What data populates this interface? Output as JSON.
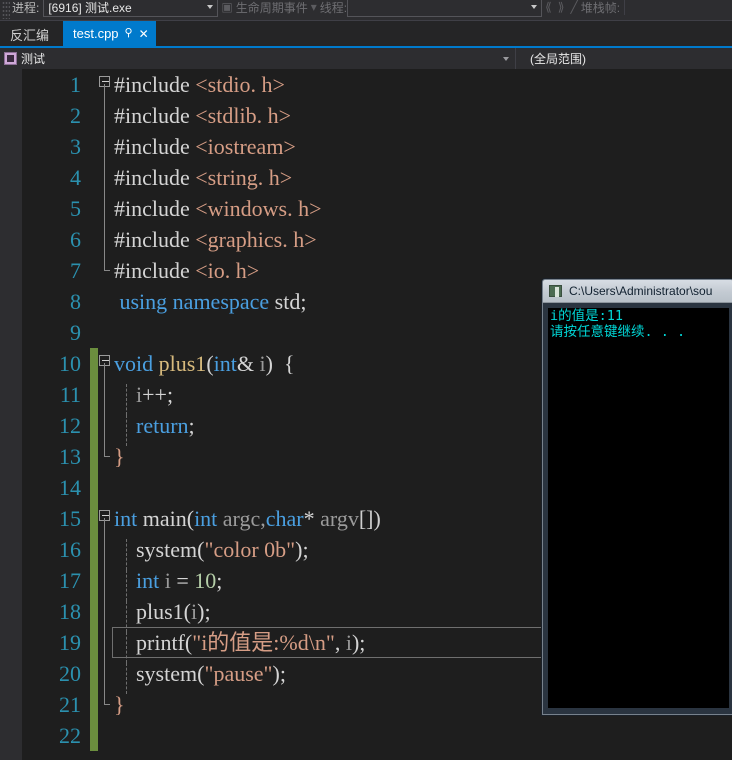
{
  "toolbar": {
    "process_label": "进程:",
    "process_value": "[6916] 测试.exe",
    "lifecycle_label": "生命周期事件",
    "thread_label": "线程:",
    "thread_value": "",
    "stack_label": "堆栈帧:",
    "icons": [
      "lifecycle-icon",
      "step-back-icon",
      "step-forward-icon",
      "no-symbol-icon"
    ]
  },
  "tabs": {
    "inactive_label": "反汇编",
    "active": {
      "name": "test.cpp",
      "pin_icon": "⚲",
      "close_icon": "✕"
    }
  },
  "navbar": {
    "project_icon": "project-icon",
    "project": "测试",
    "scope": "(全局范围)"
  },
  "editor": {
    "accent_color": "#007acc",
    "changebar_color": "#6b8e3e",
    "lineno_color": "#2b91af",
    "current_line": 19,
    "lines": [
      {
        "n": 1,
        "changed": false,
        "fold": "box",
        "indent": false,
        "html": "<span class=\"pl\">#include </span><span class=\"inc\">&lt;stdio. h&gt;</span>"
      },
      {
        "n": 2,
        "changed": false,
        "fold": "pipe",
        "indent": false,
        "html": "<span class=\"pl\">#include </span><span class=\"inc\">&lt;stdlib. h&gt;</span>"
      },
      {
        "n": 3,
        "changed": false,
        "fold": "pipe",
        "indent": false,
        "html": "<span class=\"pl\">#include </span><span class=\"inc\">&lt;iostream&gt;</span>"
      },
      {
        "n": 4,
        "changed": false,
        "fold": "pipe",
        "indent": false,
        "html": "<span class=\"pl\">#include </span><span class=\"inc\">&lt;string. h&gt;</span>"
      },
      {
        "n": 5,
        "changed": false,
        "fold": "pipe",
        "indent": false,
        "html": "<span class=\"pl\">#include </span><span class=\"inc\">&lt;windows. h&gt;</span>"
      },
      {
        "n": 6,
        "changed": false,
        "fold": "pipe",
        "indent": false,
        "html": "<span class=\"pl\">#include </span><span class=\"inc\">&lt;graphics. h&gt;</span>"
      },
      {
        "n": 7,
        "changed": false,
        "fold": "elbow",
        "indent": false,
        "html": "<span class=\"pl\">#include </span><span class=\"inc\">&lt;io. h&gt;</span>"
      },
      {
        "n": 8,
        "changed": false,
        "fold": "none",
        "indent": false,
        "html": " <span class=\"kw\">using namespace</span> <span class=\"pl\">std;</span>"
      },
      {
        "n": 9,
        "changed": false,
        "fold": "none",
        "indent": false,
        "html": ""
      },
      {
        "n": 10,
        "changed": true,
        "fold": "box",
        "indent": false,
        "html": "<span class=\"kw\">void</span> <span class=\"fn\">plus1</span><span class=\"pl\">(</span><span class=\"kw\">int</span><span class=\"pl\">&amp; </span><span class=\"id\">i</span><span class=\"pl\">)  {</span>"
      },
      {
        "n": 11,
        "changed": true,
        "fold": "pipe",
        "indent": true,
        "html": "    <span class=\"id\">i</span><span class=\"pl\">++;</span>"
      },
      {
        "n": 12,
        "changed": true,
        "fold": "pipe",
        "indent": true,
        "html": "    <span class=\"kw\">return</span><span class=\"pl\">;</span>"
      },
      {
        "n": 13,
        "changed": true,
        "fold": "elbow",
        "indent": false,
        "html": "<span class=\"str\">}</span>"
      },
      {
        "n": 14,
        "changed": true,
        "fold": "none",
        "indent": false,
        "html": ""
      },
      {
        "n": 15,
        "changed": true,
        "fold": "box",
        "indent": false,
        "html": "<span class=\"kw\">int</span> <span class=\"pl\">main(</span><span class=\"kw\">int</span> <span class=\"id\">argc,</span><span class=\"kw\">char</span><span class=\"pl\">* </span><span class=\"id\">argv</span><span class=\"brk\">[])</span>"
      },
      {
        "n": 16,
        "changed": true,
        "fold": "pipe",
        "indent": true,
        "html": "    <span class=\"pl\">system(</span><span class=\"dq\">&quot;</span><span class=\"str\">color 0b</span><span class=\"dq\">&quot;</span><span class=\"pl\">);</span>"
      },
      {
        "n": 17,
        "changed": true,
        "fold": "pipe",
        "indent": true,
        "html": "    <span class=\"kw\">int</span> <span class=\"id\">i</span> <span class=\"pl\">= </span><span class=\"num\">10</span><span class=\"pl\">;</span>"
      },
      {
        "n": 18,
        "changed": true,
        "fold": "pipe",
        "indent": true,
        "html": "    <span class=\"pl\">plus1(</span><span class=\"id\">i</span><span class=\"pl\">);</span>"
      },
      {
        "n": 19,
        "changed": true,
        "fold": "pipe",
        "indent": true,
        "html": "    <span class=\"pl\">printf(</span><span class=\"dq\">&quot;</span><span class=\"str\">i的值是:%d\\n</span><span class=\"dq\">&quot;</span><span class=\"pl\">, </span><span class=\"id\">i</span><span class=\"pl\">);</span>"
      },
      {
        "n": 20,
        "changed": true,
        "fold": "pipe",
        "indent": true,
        "html": "    <span class=\"pl\">system(</span><span class=\"dq\">&quot;</span><span class=\"str\">pause</span><span class=\"dq\">&quot;</span><span class=\"pl\">);</span>"
      },
      {
        "n": 21,
        "changed": true,
        "fold": "elbow",
        "indent": false,
        "html": "<span class=\"str\">}</span>"
      },
      {
        "n": 22,
        "changed": true,
        "fold": "none",
        "indent": false,
        "html": ""
      }
    ]
  },
  "console": {
    "icon": "console-icon",
    "title": "C:\\Users\\Administrator\\sou",
    "text_color": "#00d7d7",
    "lines": [
      "i的值是:11",
      "请按任意键继续. . ."
    ]
  }
}
